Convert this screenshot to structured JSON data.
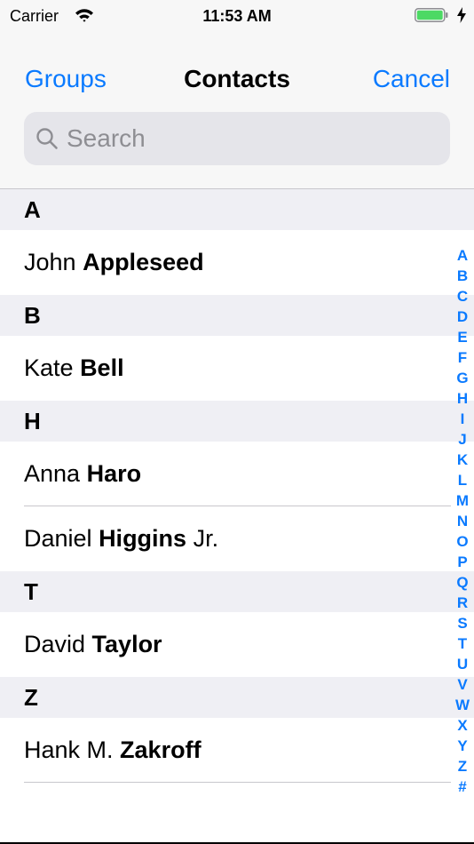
{
  "status_bar": {
    "carrier": "Carrier",
    "time": "11:53 AM",
    "battery_color": "#4cd964"
  },
  "nav": {
    "left_button": "Groups",
    "title": "Contacts",
    "right_button": "Cancel"
  },
  "search": {
    "placeholder": "Search"
  },
  "colors": {
    "accent": "#0a7aff",
    "section_background": "#efeff4",
    "separator": "#c8c7cc"
  },
  "sections": [
    {
      "letter": "A",
      "contacts": [
        {
          "first": "John",
          "last": "Appleseed",
          "suffix": ""
        }
      ]
    },
    {
      "letter": "B",
      "contacts": [
        {
          "first": "Kate",
          "last": "Bell",
          "suffix": ""
        }
      ]
    },
    {
      "letter": "H",
      "contacts": [
        {
          "first": "Anna",
          "last": "Haro",
          "suffix": ""
        },
        {
          "first": "Daniel",
          "last": "Higgins",
          "suffix": "Jr."
        }
      ]
    },
    {
      "letter": "T",
      "contacts": [
        {
          "first": "David",
          "last": "Taylor",
          "suffix": ""
        }
      ]
    },
    {
      "letter": "Z",
      "contacts": [
        {
          "first": "Hank M.",
          "last": "Zakroff",
          "suffix": ""
        }
      ]
    }
  ],
  "index": [
    "A",
    "B",
    "C",
    "D",
    "E",
    "F",
    "G",
    "H",
    "I",
    "J",
    "K",
    "L",
    "M",
    "N",
    "O",
    "P",
    "Q",
    "R",
    "S",
    "T",
    "U",
    "V",
    "W",
    "X",
    "Y",
    "Z",
    "#"
  ]
}
